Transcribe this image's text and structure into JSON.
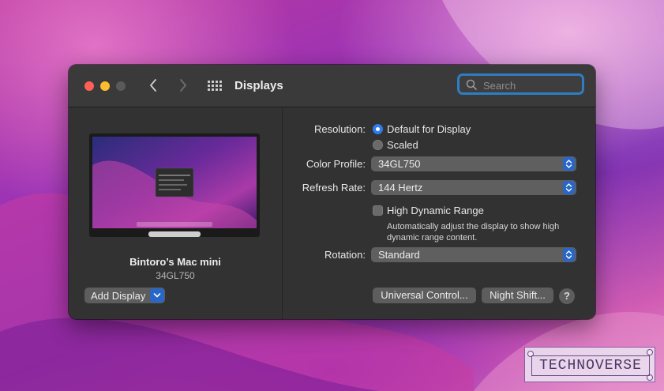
{
  "window": {
    "title": "Displays",
    "search_placeholder": "Search"
  },
  "display": {
    "name": "Bintoro’s Mac mini",
    "model": "34GL750",
    "add_display_label": "Add Display"
  },
  "settings": {
    "resolution_label": "Resolution:",
    "resolution_options": [
      {
        "label": "Default for Display",
        "selected": true
      },
      {
        "label": "Scaled",
        "selected": false
      }
    ],
    "color_profile_label": "Color Profile:",
    "color_profile_value": "34GL750",
    "refresh_rate_label": "Refresh Rate:",
    "refresh_rate_value": "144 Hertz",
    "hdr_label": "High Dynamic Range",
    "hdr_checked": false,
    "hdr_help_line1": "Automatically adjust the display to show high",
    "hdr_help_line2": "dynamic range content.",
    "rotation_label": "Rotation:",
    "rotation_value": "Standard"
  },
  "buttons": {
    "universal_control": "Universal Control...",
    "night_shift": "Night Shift...",
    "help": "?"
  },
  "watermark": {
    "text": "TECHNOVERSE"
  },
  "icons": {
    "back": "chevron-left-icon",
    "forward": "chevron-right-icon",
    "grid": "grid-icon",
    "search": "search-icon"
  },
  "colors": {
    "accent": "#2866c8",
    "close": "#fe5f57",
    "minimize": "#febc2e"
  }
}
